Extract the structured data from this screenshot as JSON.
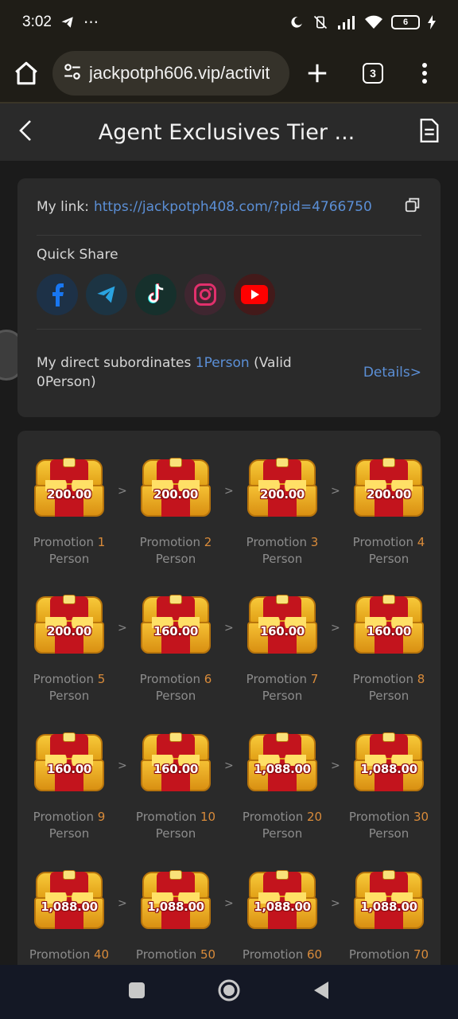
{
  "status_bar": {
    "time": "3:02",
    "dots": "⋯",
    "battery_level": "6"
  },
  "browser": {
    "url": "jackpotph606.vip/activit",
    "tab_count": "3"
  },
  "header": {
    "title": "Agent Exclusives Tier ..."
  },
  "link_card": {
    "my_link_label": "My link:",
    "my_link_url": "https://jackpotph408.com/?pid=4766750",
    "quick_share_label": "Quick Share",
    "socials": [
      "facebook-icon",
      "telegram-icon",
      "tiktok-icon",
      "instagram-icon",
      "youtube-icon"
    ],
    "subs_prefix": "My direct subordinates ",
    "subs_count": "1Person",
    "subs_valid": " (Valid 0Person)",
    "details_label": "Details>"
  },
  "tiers": [
    {
      "amount": "200.00",
      "prefix": "Promotion ",
      "num": "1",
      "suffix": "Person"
    },
    {
      "amount": "200.00",
      "prefix": "Promotion ",
      "num": "2",
      "suffix": "Person"
    },
    {
      "amount": "200.00",
      "prefix": "Promotion ",
      "num": "3",
      "suffix": "Person"
    },
    {
      "amount": "200.00",
      "prefix": "Promotion ",
      "num": "4",
      "suffix": "Person"
    },
    {
      "amount": "200.00",
      "prefix": "Promotion ",
      "num": "5",
      "suffix": "Person"
    },
    {
      "amount": "160.00",
      "prefix": "Promotion ",
      "num": "6",
      "suffix": "Person"
    },
    {
      "amount": "160.00",
      "prefix": "Promotion ",
      "num": "7",
      "suffix": "Person"
    },
    {
      "amount": "160.00",
      "prefix": "Promotion ",
      "num": "8",
      "suffix": "Person"
    },
    {
      "amount": "160.00",
      "prefix": "Promotion ",
      "num": "9",
      "suffix": "Person"
    },
    {
      "amount": "160.00",
      "prefix": "Promotion ",
      "num": "10",
      "suffix": "Person"
    },
    {
      "amount": "1,088.00",
      "prefix": "Promotion ",
      "num": "20",
      "suffix": "Person"
    },
    {
      "amount": "1,088.00",
      "prefix": "Promotion ",
      "num": "30",
      "suffix": "Person"
    },
    {
      "amount": "1,088.00",
      "prefix": "Promotion ",
      "num": "40",
      "suffix": ""
    },
    {
      "amount": "1,088.00",
      "prefix": "Promotion ",
      "num": "50",
      "suffix": ""
    },
    {
      "amount": "1,088.00",
      "prefix": "Promotion ",
      "num": "60",
      "suffix": ""
    },
    {
      "amount": "1,088.00",
      "prefix": "Promotion ",
      "num": "70",
      "suffix": ""
    }
  ],
  "arrow_glyph": ">"
}
